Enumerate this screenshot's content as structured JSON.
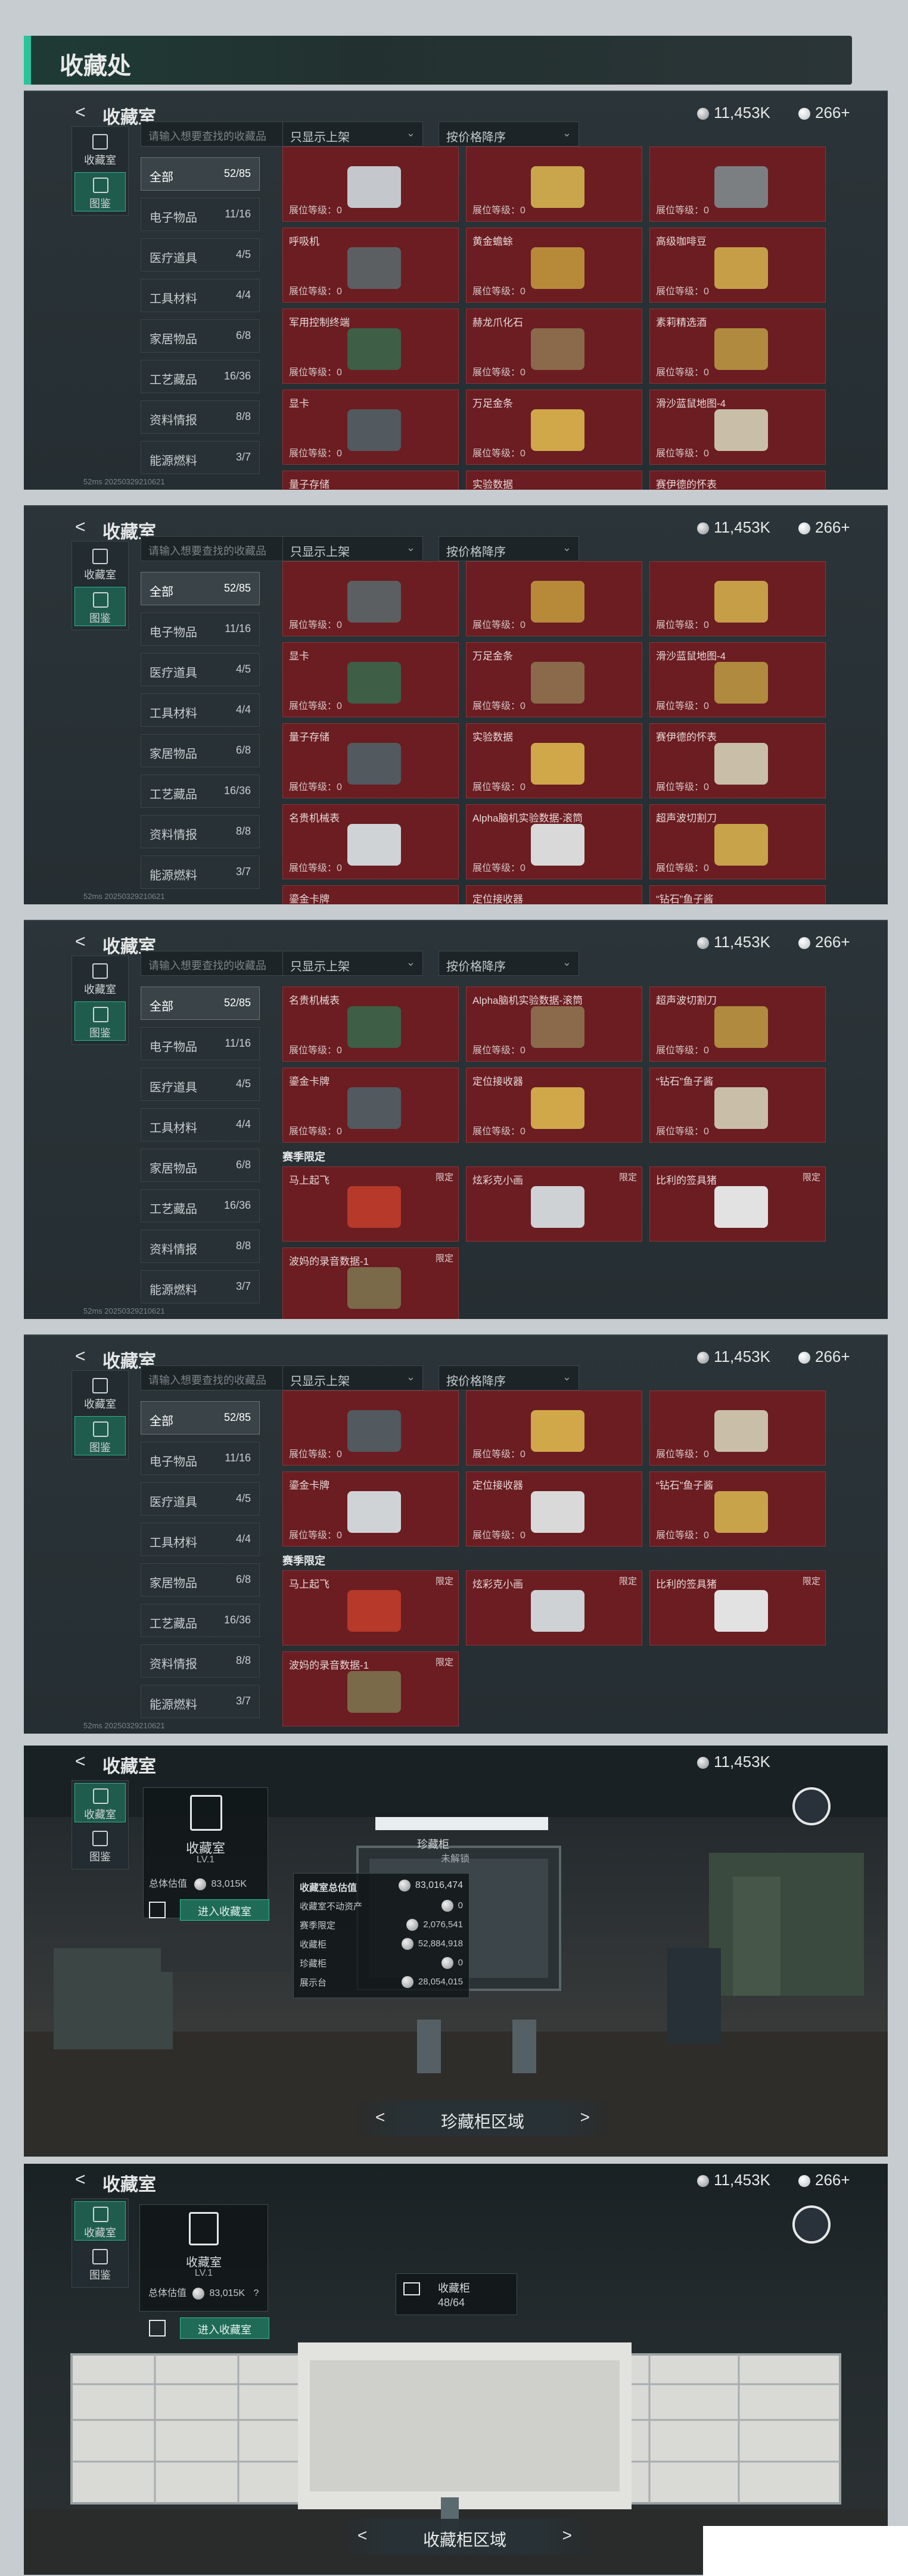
{
  "header": {
    "title": "收藏处"
  },
  "common": {
    "back": "<",
    "title": "收藏室",
    "coins": "11,453K",
    "gems": "266+",
    "side_tabs": [
      "收藏室",
      "图鉴"
    ],
    "search_placeholder": "请输入想要查找的收藏品",
    "filter1": "只显示上架",
    "filter2": "按价格降序",
    "categories": [
      {
        "label": "全部",
        "count": "52/85"
      },
      {
        "label": "电子物品",
        "count": "11/16"
      },
      {
        "label": "医疗道具",
        "count": "4/5"
      },
      {
        "label": "工具材料",
        "count": "4/4"
      },
      {
        "label": "家居物品",
        "count": "6/8"
      },
      {
        "label": "工艺藏品",
        "count": "16/36"
      },
      {
        "label": "资料情报",
        "count": "8/8"
      },
      {
        "label": "能源燃料",
        "count": "3/7"
      }
    ],
    "level_label": "展位等级：0",
    "limit_label": "限定",
    "season_label": "赛季限定",
    "footer": "52ms  20250329210621"
  },
  "p1": {
    "names": [
      "",
      "",
      "",
      "呼吸机",
      "黄金蟾蜍",
      "高级咖啡豆",
      "军用控制终端",
      "赫龙爪化石",
      "素莉精选酒",
      "显卡",
      "万足金条",
      "滑沙蓝鼠地图-4",
      "量子存储",
      "实验数据",
      "赛伊德的怀表"
    ]
  },
  "p2": {
    "names": [
      "",
      "",
      "",
      "显卡",
      "万足金条",
      "滑沙蓝鼠地图-4",
      "量子存储",
      "实验数据",
      "赛伊德的怀表",
      "名贵机械表",
      "Alpha脑机实验数据-滚筒",
      "超声波切割刀",
      "鎏金卡牌",
      "定位接收器",
      "“钻石”鱼子酱"
    ]
  },
  "p3": {
    "names": [
      "名贵机械表",
      "Alpha脑机实验数据-滚筒",
      "超声波切割刀",
      "鎏金卡牌",
      "定位接收器",
      "“钻石”鱼子酱"
    ],
    "season": [
      "马上起飞",
      "炫彩克小画",
      "比利的签具猪",
      "波妈的录音数据-1"
    ]
  },
  "p4": {
    "names": [
      "",
      "",
      "",
      "鎏金卡牌",
      "定位接收器",
      "“钻石”鱼子酱"
    ],
    "season": [
      "马上起飞",
      "炫彩克小画",
      "比利的签具猪",
      "波妈的录音数据-1"
    ]
  },
  "scene1": {
    "room": "收藏室",
    "level": "LV.1",
    "value_label": "总体估值",
    "value": "83,015K",
    "enter": "进入收藏室",
    "summary_title": "收藏室总估值",
    "summary_total": "83,016,474",
    "rows": [
      {
        "label": "收藏室不动资产",
        "value": "0"
      },
      {
        "label": "赛季限定",
        "value": "2,076,541"
      },
      {
        "label": "收藏柜",
        "value": "52,884,918"
      },
      {
        "label": "珍藏柜",
        "value": "0"
      },
      {
        "label": "展示台",
        "value": "28,054,015"
      }
    ],
    "cabinet": "珍藏柜",
    "cabinet_status": "未解锁",
    "area": "珍藏柜区域"
  },
  "scene2": {
    "room": "收藏室",
    "level": "LV.1",
    "value_label": "总体估值",
    "value": "83,015K",
    "help": "?",
    "enter": "进入收藏室",
    "cabinet": "收藏柜",
    "cabinet_count": "48/64",
    "area": "收藏柜区域"
  }
}
